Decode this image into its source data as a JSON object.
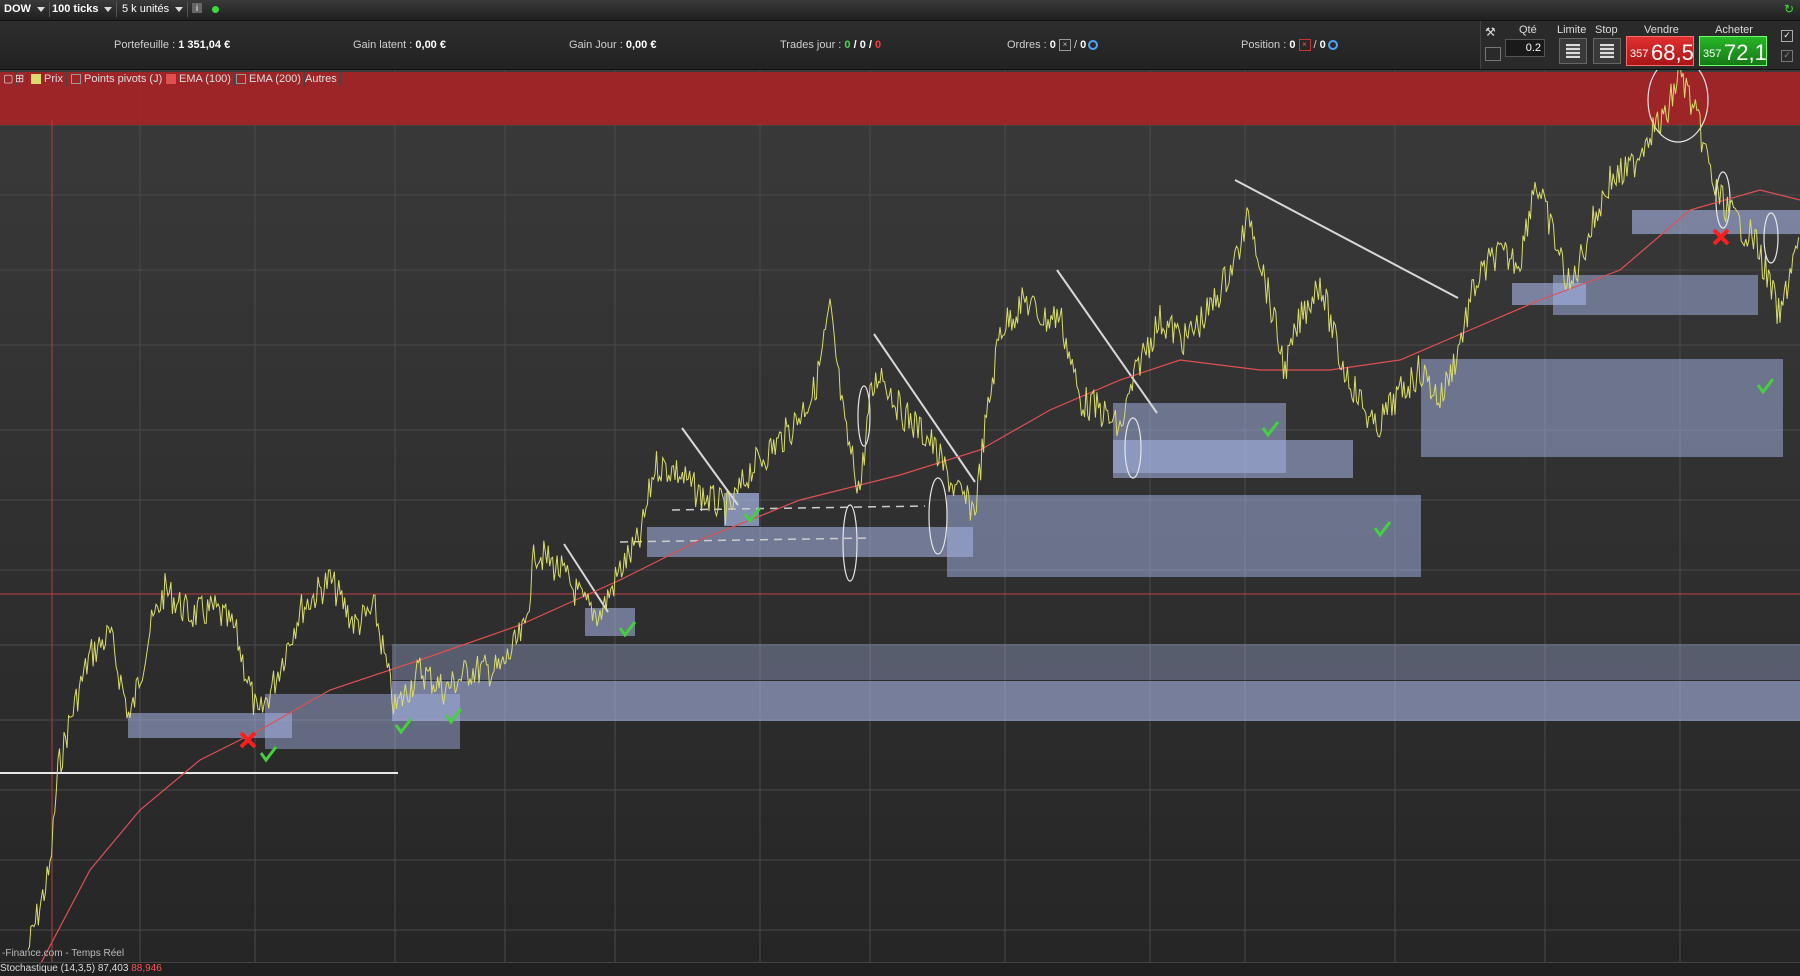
{
  "topbar": {
    "instrument": "DOW",
    "interval": "100 ticks",
    "units": "5 k unités",
    "info": "i"
  },
  "status": {
    "portfolio_label": "Portefeuille :",
    "portfolio_value": "1 351,04 €",
    "latent_label": "Gain latent :",
    "latent_value": "0,00 €",
    "day_label": "Gain Jour :",
    "day_value": "0,00 €",
    "trades_label": "Trades jour :",
    "trades_a": "0",
    "trades_b": "0",
    "trades_c": "0",
    "orders_label": "Ordres :",
    "orders_a": "0",
    "orders_b": "0",
    "position_label": "Position :",
    "position_a": "0",
    "position_b": "0"
  },
  "order_panel": {
    "qty_label": "Qté",
    "qty_value": "0.2",
    "limit_label": "Limite",
    "stop_label": "Stop",
    "sell_label": "Vendre",
    "buy_label": "Acheter",
    "sell_small": "357",
    "sell_big": "68,5",
    "buy_small": "357",
    "buy_big": "72,1"
  },
  "toolbar": {
    "price": "Prix",
    "pivots": "Points pivots (J)",
    "ema100": "EMA (100)",
    "ema200": "EMA (200)",
    "others": "Autres"
  },
  "footer": {
    "source": "-Finance.com - Temps Réel",
    "stoch_label": "Stochastique (14,3,5)",
    "stoch_value1": "87,403",
    "stoch_value2": "88,946"
  },
  "colors": {
    "price_line": "#d9dc6a",
    "ema_line": "#e05050",
    "zone": "#a8b6e8",
    "resistance": "#c2282b",
    "check": "#43d13f",
    "cross": "#ff1e1e"
  }
}
